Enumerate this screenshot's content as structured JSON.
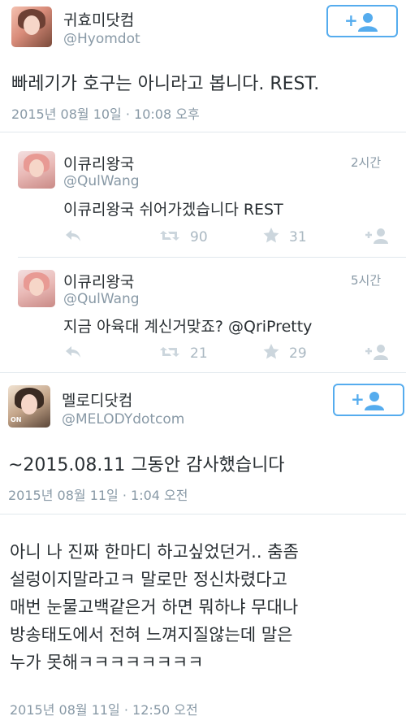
{
  "tweet1": {
    "name": "귀효미닷컴",
    "handle": "@Hyomdot",
    "text": "빠레기가 호구는 아니라고 봅니다. REST.",
    "date": "2015년 08월 10일 · 10:08 오후",
    "follow_icon": "add-person-icon"
  },
  "reply1": {
    "name": "이큐리왕국",
    "handle": "@QulWang",
    "time": "2시간",
    "text": "이큐리왕국 쉬어가겠습니다 REST",
    "retweets": "90",
    "likes": "31"
  },
  "reply2": {
    "name": "이큐리왕국",
    "handle": "@QulWang",
    "time": "5시간",
    "text": "지금 아육대 계신거맞죠? @QriPretty",
    "retweets": "21",
    "likes": "29"
  },
  "tweet2": {
    "name": "멜로디닷컴",
    "handle": "@MELODYdotcom",
    "avatar_badge": "ON",
    "text": "~2015.08.11 그동안 감사했습니다",
    "date": "2015년 08월 11일 · 1:04 오전",
    "text2_lines": [
      "아니 나 진짜 한마디 하고싶었던거.. 춤좀",
      "설렁이지말라고ㅋ 말로만 정신차렸다고",
      "매번 눈물고백같은거 하면 뭐하냐 무대나",
      "방송태도에서 전혀 느껴지질않는데 말은",
      "누가 못해ㅋㅋㅋㅋㅋㅋㅋㅋ"
    ],
    "date2": "2015년 08월 11일 · 12:50 오전"
  },
  "colors": {
    "accent": "#55acee",
    "muted": "#8899a6",
    "text": "#292f33",
    "icon": "#ccd6dd"
  }
}
